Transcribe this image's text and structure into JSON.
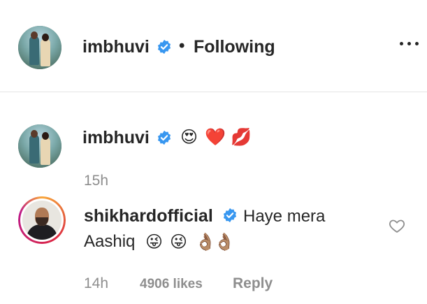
{
  "header": {
    "username": "imbhuvi",
    "separator": "•",
    "follow_status": "Following",
    "verified": true,
    "more_icon": "more-horizontal-icon"
  },
  "caption": {
    "username": "imbhuvi",
    "verified": true,
    "emojis": [
      "😍",
      "❤️",
      "💋"
    ],
    "time": "15h"
  },
  "comment": {
    "username": "shikhardofficial",
    "verified": true,
    "text_line1": "Haye mera",
    "text_line2": "Aashiq",
    "emojis": [
      "😜",
      "😜",
      "👌🏽",
      "👌🏽"
    ],
    "time": "14h",
    "likes": "4906 likes",
    "reply_label": "Reply",
    "like_icon": "heart-outline-icon"
  },
  "colors": {
    "verified_blue": "#3897f0",
    "muted_text": "#8e8e8e",
    "divider": "#e6e6e6"
  }
}
